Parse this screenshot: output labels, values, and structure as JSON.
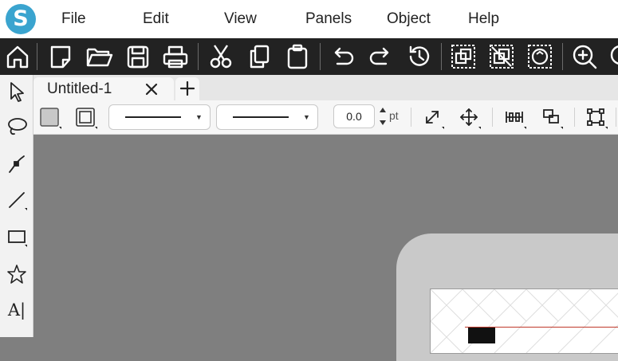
{
  "menu": {
    "items": [
      {
        "label": "File"
      },
      {
        "label": "Edit"
      },
      {
        "label": "View"
      },
      {
        "label": "Panels"
      },
      {
        "label": "Object"
      },
      {
        "label": "Help"
      }
    ]
  },
  "logo": {
    "letter": "S"
  },
  "toolbar": {
    "icons": [
      "home-icon",
      "new-document-icon",
      "open-folder-icon",
      "save-icon",
      "print-icon",
      "cut-icon",
      "copy-icon",
      "paste-icon",
      "undo-icon",
      "redo-icon",
      "history-icon",
      "group-icon",
      "ungroup-icon",
      "replicate-icon",
      "zoom-in-icon"
    ]
  },
  "tabs": [
    {
      "label": "Untitled-1"
    }
  ],
  "tab_close_glyph": "✕",
  "tab_add_glyph": "+",
  "property_bar": {
    "line_weight": "0.0",
    "line_weight_unit": "pt"
  },
  "tools": {
    "text_tool_glyph": "A|"
  },
  "colors": {
    "menubar_bg": "#ffffff",
    "toolbar_bg": "#222222",
    "workspace_bg": "#7f7f7f",
    "logo_blue": "#3aa4cf"
  }
}
